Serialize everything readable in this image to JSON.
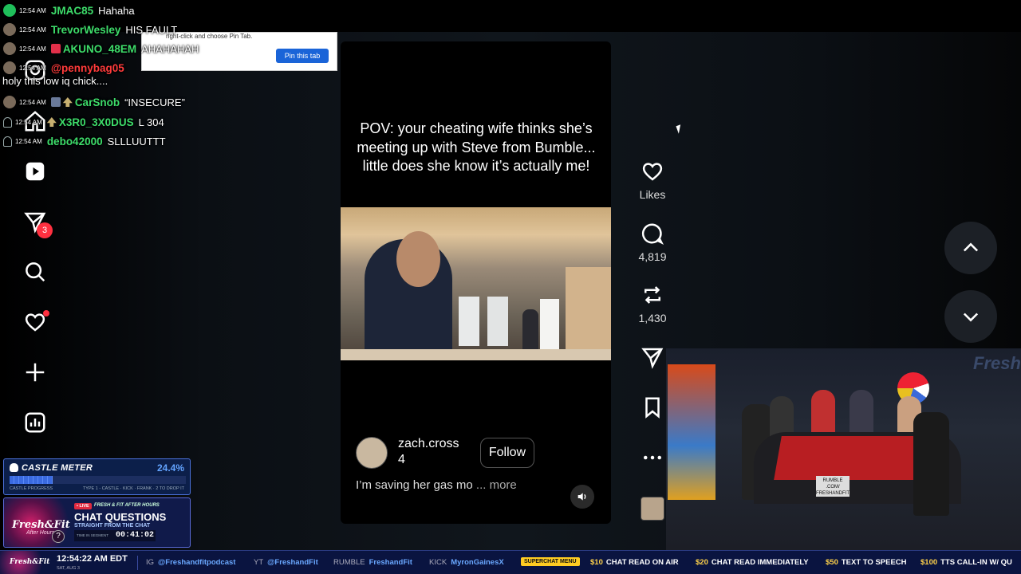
{
  "chat": {
    "messages": [
      {
        "time": "12:54 AM",
        "user": "JMAC85",
        "user_color": "#3ddc6a",
        "text": "Hahaha",
        "avatar": "green"
      },
      {
        "time": "12:54 AM",
        "user": "TrevorWesley",
        "user_color": "#3ddc6a",
        "text": "HIS FAULT",
        "avatar": "photo"
      },
      {
        "time": "12:54 AM",
        "user": "AKUNO_48EM",
        "user_color": "#3ddc6a",
        "text": "AHAHAHAH",
        "avatar": "photo"
      },
      {
        "time": "12:54 AM",
        "user": "@pennybag05",
        "user_color": "#ff3b3b",
        "text": "holy this low iq chick....",
        "avatar": "photo"
      },
      {
        "time": "12:54 AM",
        "user": "CarSnob",
        "user_color": "#3ddc6a",
        "text": "“INSECURE”",
        "avatar": "photo"
      },
      {
        "time": "12:54 AM",
        "user": "X3R0_3X0DUS",
        "user_color": "#3ddc6a",
        "text": "L 304",
        "avatar": "outline"
      },
      {
        "time": "12:54 AM",
        "user": "debo42000",
        "user_color": "#3ddc6a",
        "text": "SLLLUUTTT",
        "avatar": "outline"
      }
    ]
  },
  "pin_popup": {
    "hint": "right-click and choose Pin Tab.",
    "button": "Pin this tab"
  },
  "nav": {
    "notifications_count": "3",
    "icons": [
      "home-icon",
      "reels-icon",
      "messages-icon",
      "search-icon",
      "heart-icon",
      "create-icon",
      "insights-icon"
    ]
  },
  "reel": {
    "caption": "POV: your cheating wife thinks she’s meeting up with Steve from Bumble... little does she know it’s actually me!",
    "author_name": "zach.cross",
    "author_sub": "4",
    "follow_label": "Follow",
    "description": "I’m saving her gas mo",
    "more_label": "... more"
  },
  "actions": {
    "likes_label": "Likes",
    "comments_count": "4,819",
    "reposts_count": "1,430"
  },
  "castle_meter": {
    "title": "CASTLE METER",
    "percent": "24.4%",
    "progress": 0.244,
    "progress_label": "CASTLE PROGRESS",
    "types_label": "TYPE 1 - CASTLE · KICK · FRANK · 2 TO DROP IT"
  },
  "chat_questions": {
    "brand": "Fresh&Fit",
    "brand_sub": "After Hours",
    "live": "• LIVE",
    "subtitle": "FRESH & FIT AFTER HOURS",
    "title": "CHAT QUESTIONS",
    "tagline": "STRAIGHT FROM THE CHAT",
    "time_label": "TIME IN SEGMENT",
    "time_value": "00:41:02"
  },
  "studio": {
    "logo": "Fresh",
    "sign": "RUMBLE .COM/ FRESHANDFIT"
  },
  "ticker": {
    "brand": "Fresh&Fit",
    "clock": "12:54:22 AM EDT",
    "date": "SAT, AUG 3",
    "ig_label": "IG",
    "ig_value": "@Freshandfitpodcast",
    "yt_label": "YT",
    "yt_value": "@FreshandFit",
    "rumble_label": "RUMBLE",
    "rumble_value": "FreshandFit",
    "kick_label": "KICK",
    "kick_value": "MyronGainesX",
    "superchat_menu": "SUPERCHAT MENU",
    "items": [
      {
        "price": "$10",
        "text": "CHAT READ ON AIR"
      },
      {
        "price": "$20",
        "text": "CHAT READ IMMEDIATELY"
      },
      {
        "price": "$50",
        "text": "TEXT TO SPEECH"
      },
      {
        "price": "$100",
        "text": "TTS CALL-IN W/ QU"
      }
    ]
  }
}
